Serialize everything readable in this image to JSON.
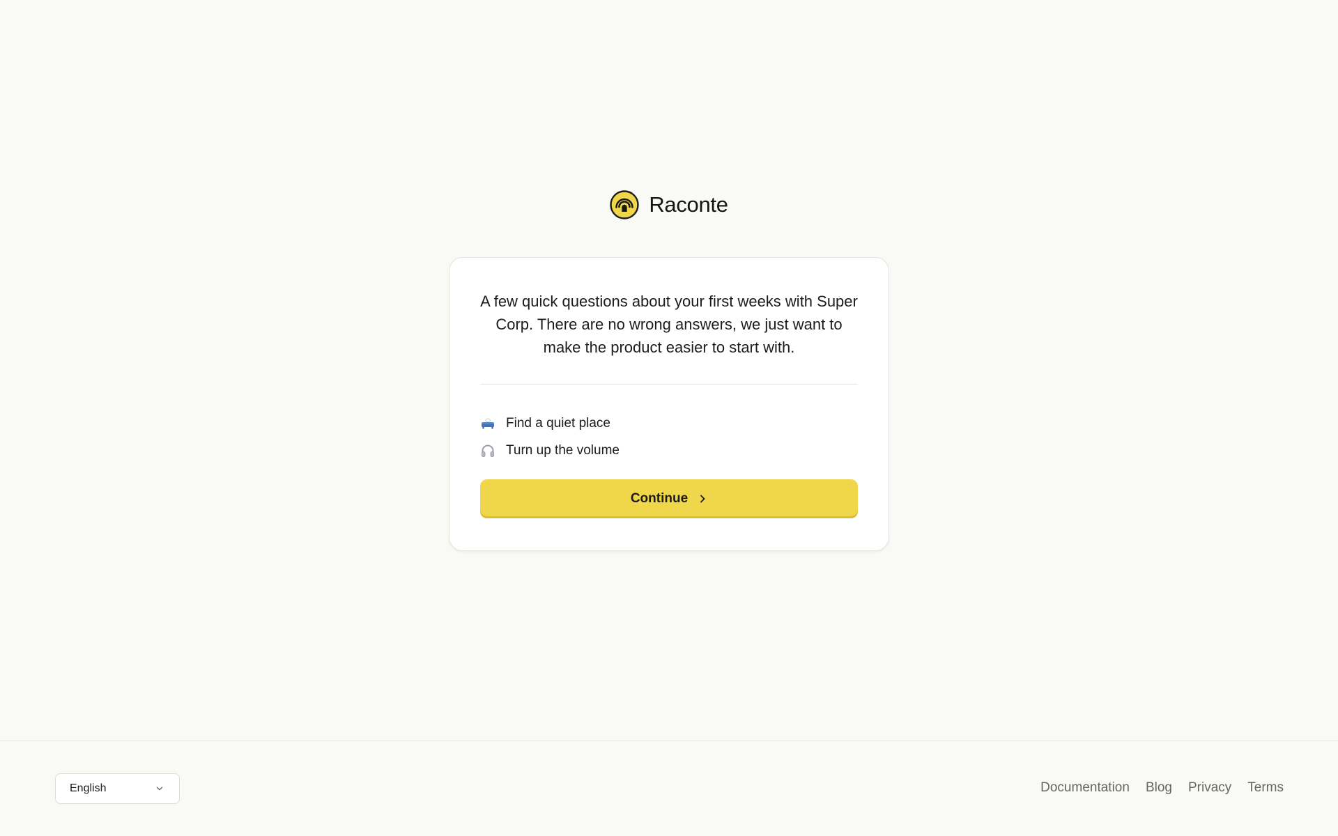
{
  "brand": {
    "name": "Raconte",
    "logo_icon": "raconte-logo-icon",
    "accent_color": "#f0d64a"
  },
  "card": {
    "intro": "A few quick questions about your first weeks with Super Corp. There are no wrong answers, we just want to make the product easier to start with.",
    "tips": [
      {
        "icon": "couch-icon",
        "label": "Find a quiet place"
      },
      {
        "icon": "headphones-icon",
        "label": "Turn up the volume"
      }
    ],
    "continue_label": "Continue",
    "continue_icon": "chevron-right-icon"
  },
  "footer": {
    "language": {
      "selected": "English",
      "icon": "chevron-down-icon"
    },
    "links": [
      "Documentation",
      "Blog",
      "Privacy",
      "Terms"
    ]
  }
}
